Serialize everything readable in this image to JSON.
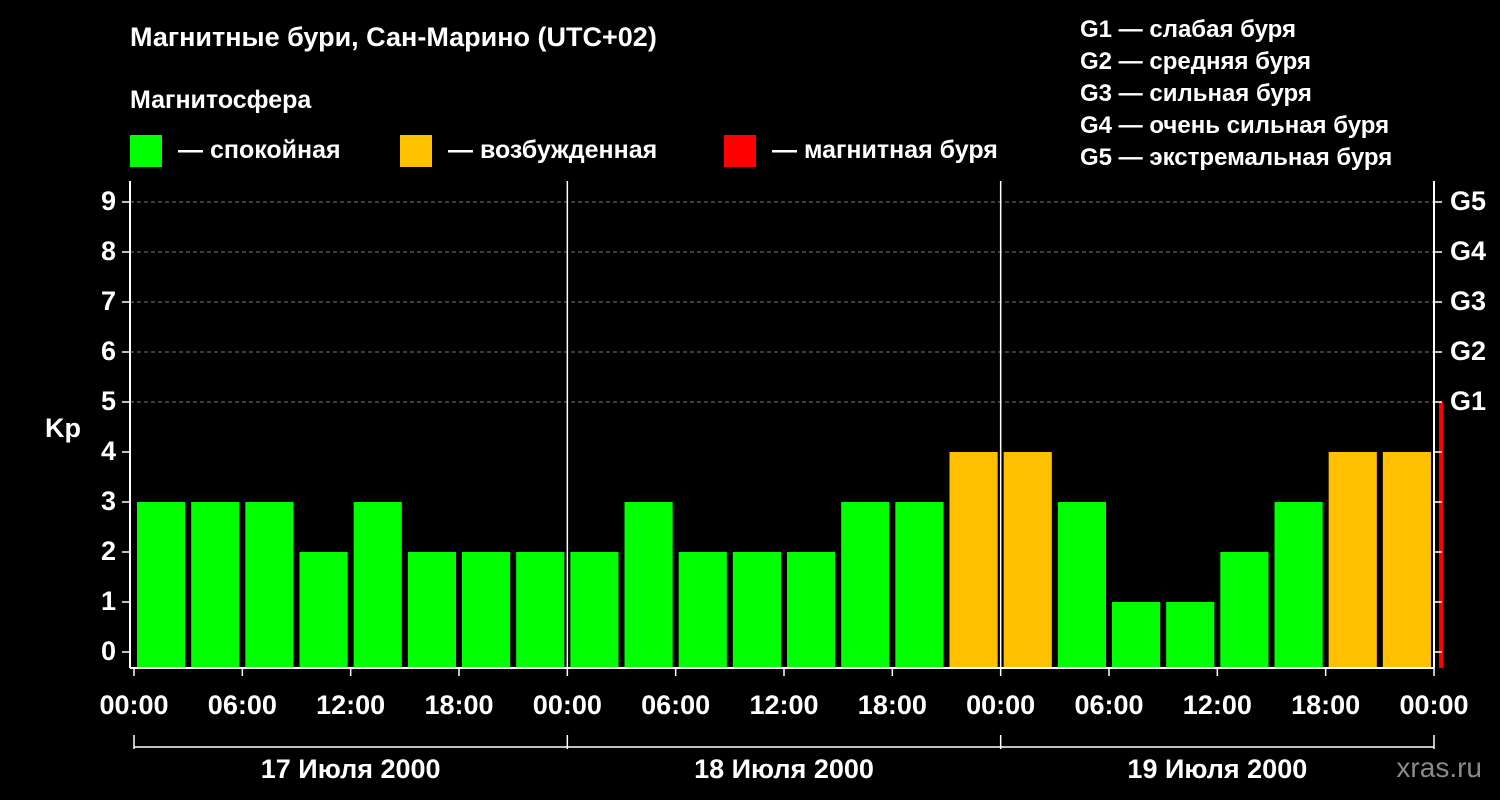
{
  "title": "Магнитные бури, Сан-Марино (UTC+02)",
  "subtitle": "Магнитосфера",
  "legend": [
    {
      "label": "— спокойная",
      "color": "#00ff00"
    },
    {
      "label": "— возбужденная",
      "color": "#ffc000"
    },
    {
      "label": "— магнитная буря",
      "color": "#ff0000"
    }
  ],
  "storm_levels": [
    "G1 — слабая буря",
    "G2 — средняя буря",
    "G3 — сильная буря",
    "G4 — очень сильная буря",
    "G5 — экстремальная буря"
  ],
  "watermark": "xras.ru",
  "chart_data": {
    "type": "bar",
    "ylabel": "Kp",
    "ylim": [
      0,
      9
    ],
    "yticks": [
      "0",
      "1",
      "2",
      "3",
      "4",
      "5",
      "6",
      "7",
      "8",
      "9"
    ],
    "right_ticks": [
      {
        "kp": 5,
        "label": "G1"
      },
      {
        "kp": 6,
        "label": "G2"
      },
      {
        "kp": 7,
        "label": "G3"
      },
      {
        "kp": 8,
        "label": "G4"
      },
      {
        "kp": 9,
        "label": "G5"
      }
    ],
    "grid": "dashed horizontal at Kp 5–9",
    "xticks": [
      "00:00",
      "06:00",
      "12:00",
      "18:00",
      "00:00",
      "06:00",
      "12:00",
      "18:00",
      "00:00",
      "06:00",
      "12:00",
      "18:00",
      "00:00"
    ],
    "days": [
      "17 Июля 2000",
      "18 Июля 2000",
      "19 Июля 2000"
    ],
    "interval_hours": 3,
    "values": [
      3,
      3,
      3,
      2,
      3,
      2,
      2,
      2,
      2,
      3,
      2,
      2,
      2,
      3,
      3,
      4,
      4,
      3,
      1,
      1,
      2,
      3,
      4,
      4,
      5
    ],
    "categories_color": {
      "calm": "#00ff00",
      "active": "#ffc000",
      "storm": "#ff0000"
    }
  }
}
